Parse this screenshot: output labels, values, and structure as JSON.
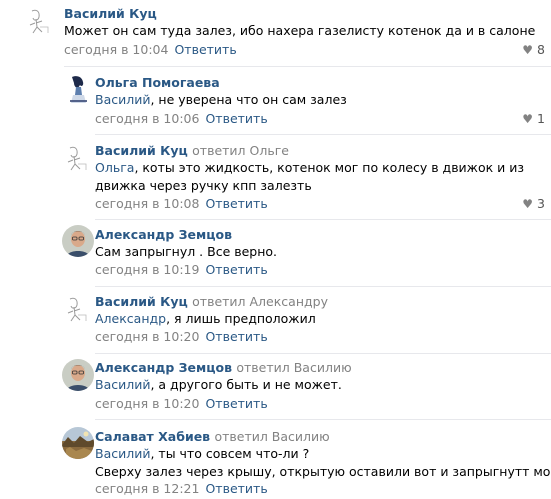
{
  "comments": [
    {
      "author": "Василий Куц",
      "relation": "",
      "mention": "",
      "lines": [
        "Может он сам туда залез, ибо нахера газелисту котенок да и в салоне"
      ],
      "time": "сегодня в 10:04",
      "reply": "Ответить",
      "likes": "8",
      "avatar": "sketch-avatar"
    },
    {
      "author": "Ольга Помогаева",
      "relation": "",
      "mention": "Василий",
      "lines": [
        ", не уверена что он сам залез"
      ],
      "time": "сегодня в 10:06",
      "reply": "Ответить",
      "likes": "1",
      "avatar": "girl-avatar"
    },
    {
      "author": "Василий Куц",
      "relation": "ответил Ольге",
      "mention": "Ольга",
      "lines": [
        ", коты это жидкость, котенок мог по колесу в движок и из",
        "движка через ручку кпп залезть"
      ],
      "time": "сегодня в 10:08",
      "reply": "Ответить",
      "likes": "3",
      "avatar": "sketch-avatar"
    },
    {
      "author": "Александр Земцов",
      "relation": "",
      "mention": "",
      "lines": [
        "Сам запрыгнул . Все верно."
      ],
      "time": "сегодня в 10:19",
      "reply": "Ответить",
      "likes": "",
      "avatar": "photo-avatar"
    },
    {
      "author": "Василий Куц",
      "relation": "ответил Александру",
      "mention": "Александр",
      "lines": [
        ", я лишь предположил"
      ],
      "time": "сегодня в 10:20",
      "reply": "Ответить",
      "likes": "",
      "avatar": "sketch-avatar"
    },
    {
      "author": "Александр Земцов",
      "relation": "ответил Василию",
      "mention": "Василий",
      "lines": [
        ", а другого быть и не может."
      ],
      "time": "сегодня в 10:20",
      "reply": "Ответить",
      "likes": "",
      "avatar": "photo-avatar"
    },
    {
      "author": "Салават Хабиев",
      "relation": "ответил Василию",
      "mention": "Василий",
      "lines": [
        ", ты что совсем что-ли ?",
        "Сверху залез через крышу, открытую оставили вот и запрыгнутт мог"
      ],
      "time": "сегодня в 12:21",
      "reply": "Ответить",
      "likes": "",
      "avatar": "landscape-avatar"
    }
  ],
  "colors": {
    "link": "#2a5885",
    "meta": "#828282",
    "divider": "#e7e8ec"
  }
}
